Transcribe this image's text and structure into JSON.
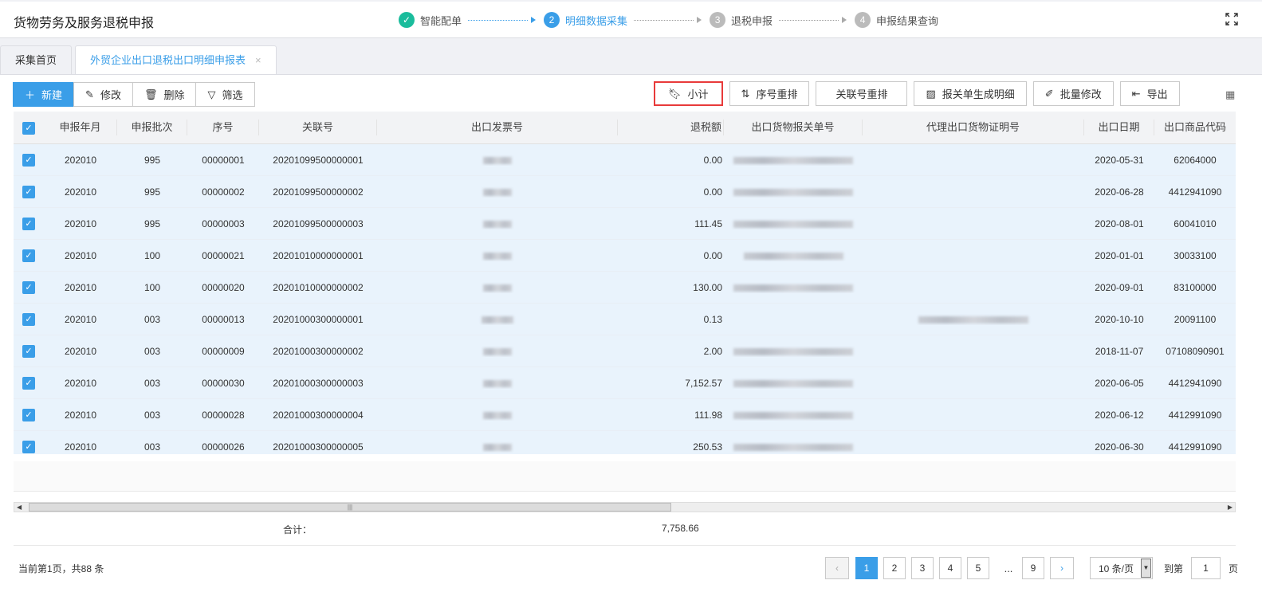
{
  "header": {
    "title": "货物劳务及服务退税申报",
    "steps": [
      {
        "num": "✓",
        "label": "智能配单"
      },
      {
        "num": "2",
        "label": "明细数据采集"
      },
      {
        "num": "3",
        "label": "退税申报"
      },
      {
        "num": "4",
        "label": "申报结果查询"
      }
    ]
  },
  "tabs": [
    {
      "label": "采集首页"
    },
    {
      "label": "外贸企业出口退税出口明细申报表",
      "close": "×"
    }
  ],
  "toolbar": {
    "new": "新建",
    "edit": "修改",
    "delete": "删除",
    "filter": "筛选",
    "subtotal": "小计",
    "reorder_seq": "序号重排",
    "reorder_link": "关联号重排",
    "gen_detail": "报关单生成明细",
    "batch_edit": "批量修改",
    "export": "导出"
  },
  "table": {
    "columns": [
      "申报年月",
      "申报批次",
      "序号",
      "关联号",
      "出口发票号",
      "退税额",
      "出口货物报关单号",
      "代理出口货物证明号",
      "出口日期",
      "出口商品代码"
    ],
    "rows": [
      [
        "202010",
        "995",
        "00000001",
        "20201099500000001",
        "0.00",
        "2020-05-31",
        "62064000"
      ],
      [
        "202010",
        "995",
        "00000002",
        "20201099500000002",
        "0.00",
        "2020-06-28",
        "4412941090"
      ],
      [
        "202010",
        "995",
        "00000003",
        "20201099500000003",
        "111.45",
        "2020-08-01",
        "60041010"
      ],
      [
        "202010",
        "100",
        "00000021",
        "20201010000000001",
        "0.00",
        "2020-01-01",
        "30033100"
      ],
      [
        "202010",
        "100",
        "00000020",
        "20201010000000002",
        "130.00",
        "2020-09-01",
        "83100000"
      ],
      [
        "202010",
        "003",
        "00000013",
        "20201000300000001",
        "0.13",
        "2020-10-10",
        "20091100"
      ],
      [
        "202010",
        "003",
        "00000009",
        "20201000300000002",
        "2.00",
        "2018-11-07",
        "07108090901"
      ],
      [
        "202010",
        "003",
        "00000030",
        "20201000300000003",
        "7,152.57",
        "2020-06-05",
        "4412941090"
      ],
      [
        "202010",
        "003",
        "00000028",
        "20201000300000004",
        "111.98",
        "2020-06-12",
        "4412991090"
      ],
      [
        "202010",
        "003",
        "00000026",
        "20201000300000005",
        "250.53",
        "2020-06-30",
        "4412991090"
      ]
    ]
  },
  "footer": {
    "total_label": "合计：",
    "total_value": "7,758.66"
  },
  "pagination": {
    "status": "当前第1页，共88 条",
    "pages": [
      "1",
      "2",
      "3",
      "4",
      "5",
      "...",
      "9"
    ],
    "page_size": "10 条/页",
    "goto_label": "到第",
    "goto_value": "1",
    "page_suffix": "页"
  }
}
